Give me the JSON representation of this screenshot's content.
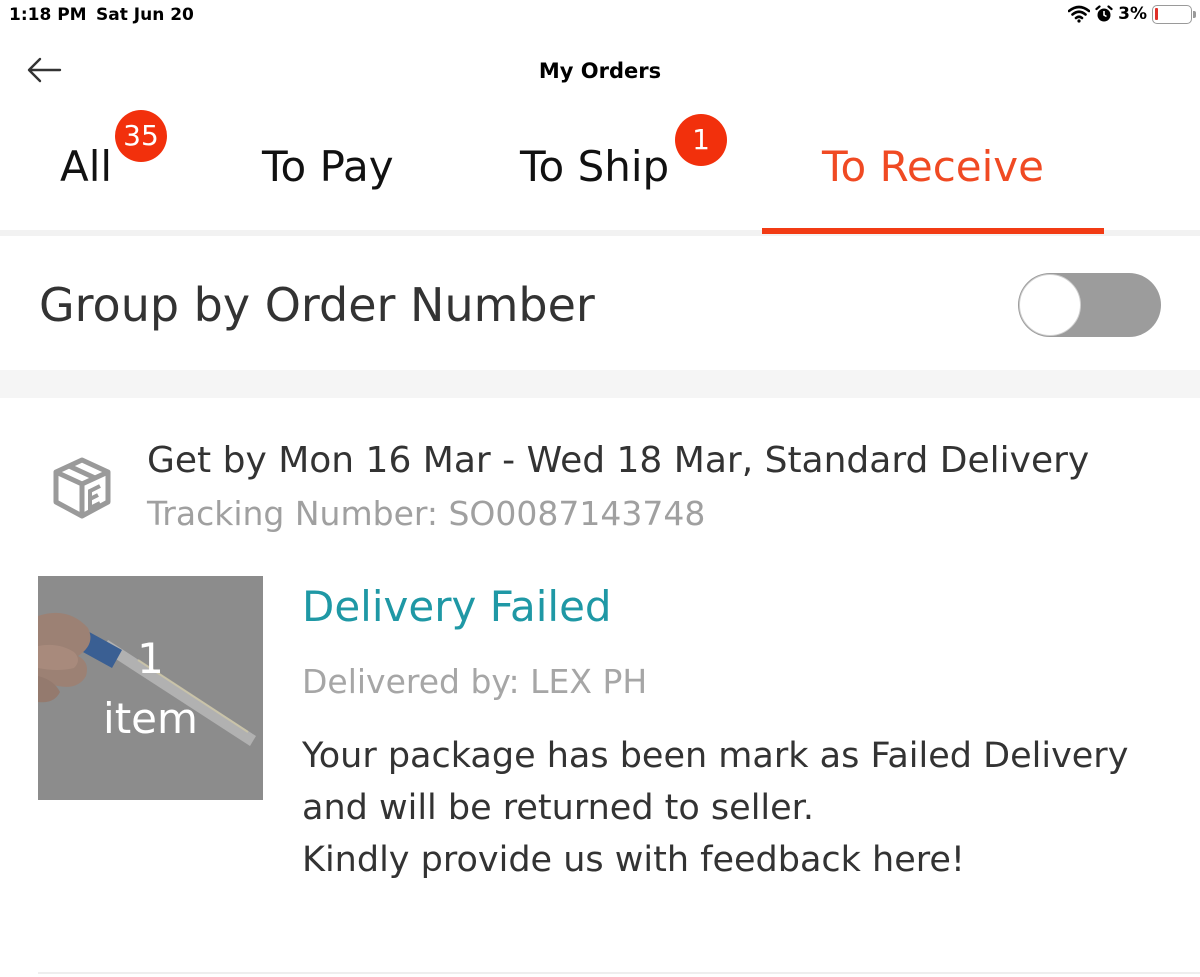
{
  "status_bar": {
    "time": "1:18 PM",
    "date": "Sat Jun 20",
    "battery": "3%",
    "icons": [
      "wifi-icon",
      "alarm-icon",
      "battery-icon"
    ]
  },
  "nav": {
    "title": "My Orders",
    "back_icon": "arrow-left-icon"
  },
  "tabs": [
    {
      "label": "All",
      "badge": "35",
      "active": false
    },
    {
      "label": "To Pay",
      "badge": null,
      "active": false
    },
    {
      "label": "To Ship",
      "badge": "1",
      "active": false
    },
    {
      "label": "To Receive",
      "badge": null,
      "active": true
    }
  ],
  "group_toggle": {
    "label": "Group by Order Number",
    "enabled": false
  },
  "delivery": {
    "icon": "package-box-icon",
    "estimate": "Get by Mon 16 Mar - Wed 18 Mar, Standard Delivery",
    "tracking": "Tracking Number: SO0087143748"
  },
  "order_item": {
    "count_number": "1",
    "count_label": "item",
    "status": "Delivery Failed",
    "delivered_by": "Delivered by: LEX PH",
    "message_lines": [
      "Your package has been mark as Failed Delivery",
      "and will be returned to seller.",
      "Kindly provide us with feedback here!"
    ]
  },
  "colors": {
    "accent": "#f04a23",
    "badge": "#f2300c",
    "status_teal": "#1f98a5",
    "toggle_off": "#9c9c9c"
  }
}
